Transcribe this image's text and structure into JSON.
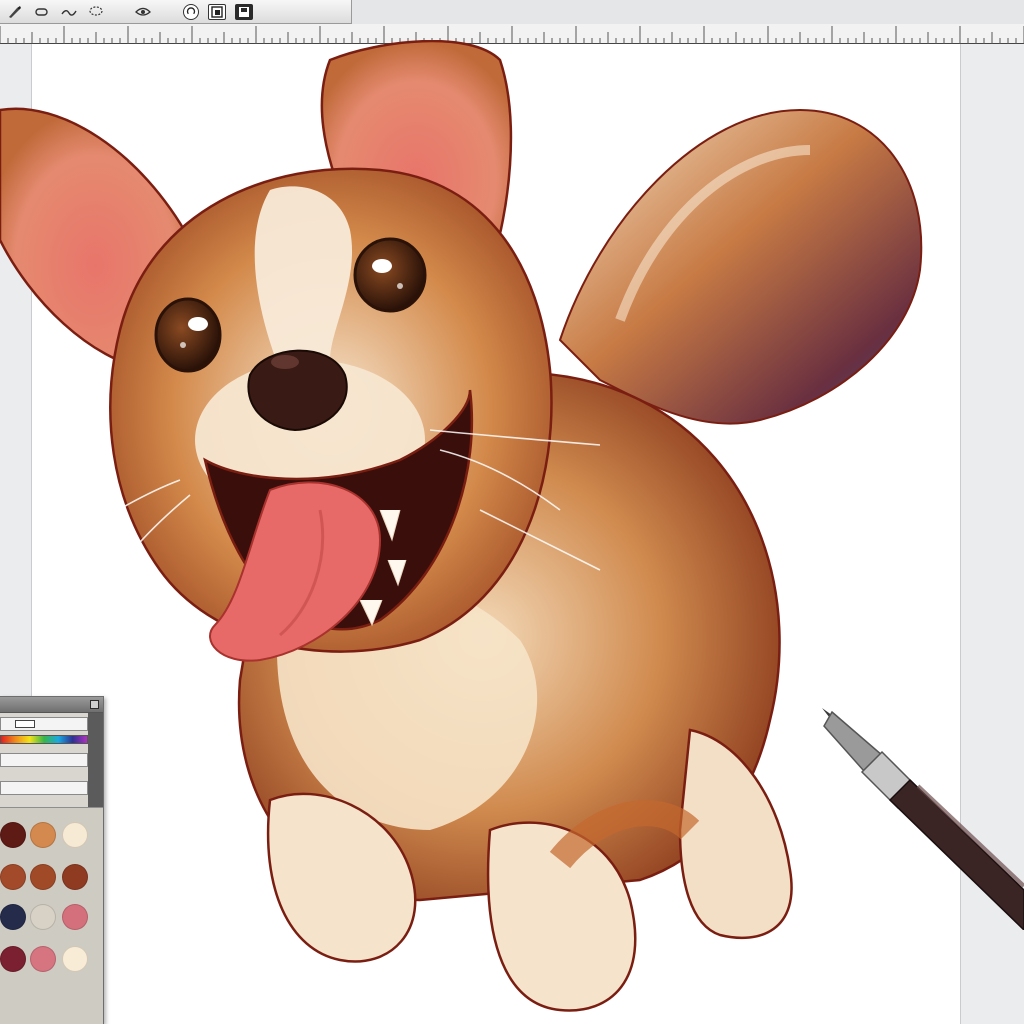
{
  "toolbar": {
    "tools": [
      {
        "name": "brush-icon"
      },
      {
        "name": "eraser-icon"
      },
      {
        "name": "smudge-icon"
      },
      {
        "name": "lasso-icon"
      },
      {
        "name": "eye-icon"
      },
      {
        "name": "rotate-icon"
      },
      {
        "name": "layer-icon"
      },
      {
        "name": "save-icon"
      }
    ]
  },
  "palette": {
    "swatches": [
      {
        "color": "#5e1a14"
      },
      {
        "color": "#d4894e"
      },
      {
        "color": "#f7ead4"
      },
      {
        "color": "#a24a2a"
      },
      {
        "color": "#a04a28"
      },
      {
        "color": "#8f3b22"
      },
      {
        "color": "#252b4a"
      },
      {
        "color": "#d8d2c6"
      },
      {
        "color": "#d4707c"
      },
      {
        "color": "#7a2030"
      },
      {
        "color": "#d67480"
      },
      {
        "color": "#f8ecd6"
      }
    ]
  },
  "colors": {
    "fur_main": "#c8743c",
    "fur_dark": "#8a3a1c",
    "fur_cream": "#f6e3c8",
    "ear_inner": "#e06a62",
    "tongue": "#e86a68",
    "tail_shadow": "#3a3f7a",
    "outline": "#7a1e12"
  }
}
